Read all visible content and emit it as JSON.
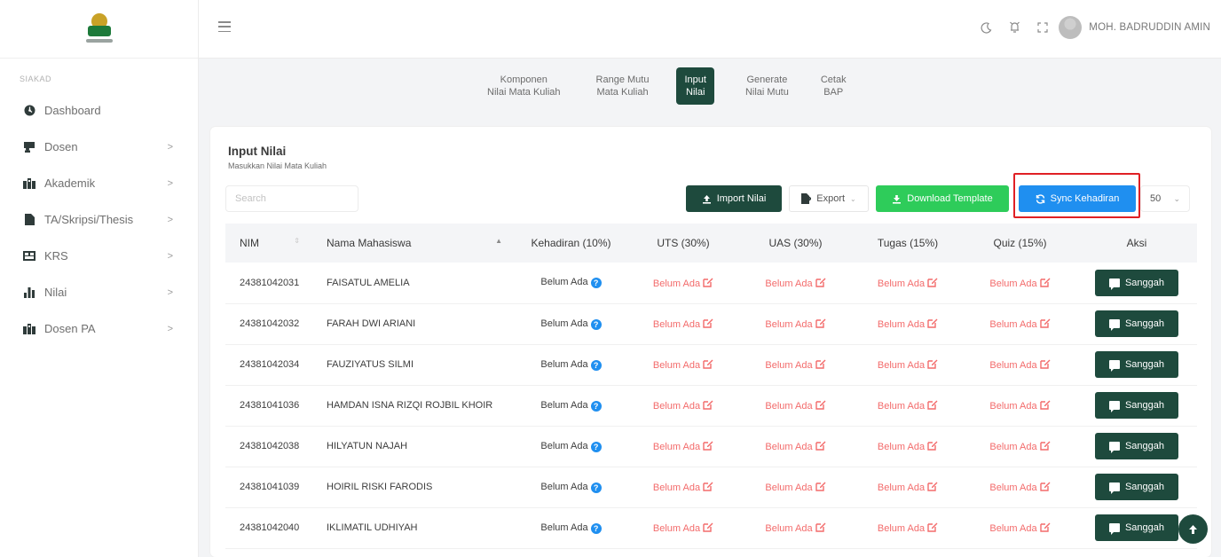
{
  "sidebar": {
    "section_label": "SIAKAD",
    "items": [
      {
        "label": "Dashboard",
        "icon": "dashboard-icon",
        "has_children": false
      },
      {
        "label": "Dosen",
        "icon": "lecturer-icon",
        "has_children": true
      },
      {
        "label": "Akademik",
        "icon": "academic-icon",
        "has_children": true
      },
      {
        "label": "TA/Skripsi/Thesis",
        "icon": "document-icon",
        "has_children": true
      },
      {
        "label": "KRS",
        "icon": "krs-icon",
        "has_children": true
      },
      {
        "label": "Nilai",
        "icon": "bar-chart-icon",
        "has_children": true
      },
      {
        "label": "Dosen PA",
        "icon": "advisor-icon",
        "has_children": true
      }
    ]
  },
  "header": {
    "user_name": "MOH. BADRUDDIN AMIN"
  },
  "tabs": [
    {
      "line1": "Komponen",
      "line2": "Nilai Mata Kuliah",
      "active": false
    },
    {
      "line1": "Range Mutu",
      "line2": "Mata Kuliah",
      "active": false
    },
    {
      "line1": "Input",
      "line2": "Nilai",
      "active": true
    },
    {
      "line1": "Generate",
      "line2": "Nilai Mutu",
      "active": false
    },
    {
      "line1": "Cetak",
      "line2": "BAP",
      "active": false
    }
  ],
  "card": {
    "title": "Input Nilai",
    "subtitle": "Masukkan Nilai Mata Kuliah"
  },
  "toolbar": {
    "search_placeholder": "Search",
    "import_label": "Import Nilai",
    "export_label": "Export",
    "template_label": "Download Template",
    "sync_label": "Sync Kehadiran",
    "per_page": "50"
  },
  "table": {
    "headers": [
      "NIM",
      "Nama Mahasiswa",
      "Kehadiran (10%)",
      "UTS (30%)",
      "UAS (30%)",
      "Tugas (15%)",
      "Quiz (15%)",
      "Aksi"
    ],
    "empty_value": "Belum Ada",
    "action_label": "Sanggah",
    "rows": [
      {
        "nim": "24381042031",
        "nama": "FAISATUL AMELIA"
      },
      {
        "nim": "24381042032",
        "nama": "FARAH DWI ARIANI"
      },
      {
        "nim": "24381042034",
        "nama": "FAUZIYATUS SILMI"
      },
      {
        "nim": "24381041036",
        "nama": "HAMDAN ISNA RIZQI ROJBIL KHOIR"
      },
      {
        "nim": "24381042038",
        "nama": "HILYATUN NAJAH"
      },
      {
        "nim": "24381041039",
        "nama": "HOIRIL RISKI FARODIS"
      },
      {
        "nim": "24381042040",
        "nama": "IKLIMATIL UDHIYAH"
      }
    ]
  },
  "colors": {
    "primary_dark_green": "#1e4a3d",
    "template_green": "#2ecc5a",
    "sync_blue": "#1f8ff0",
    "empty_red": "#f36b6b",
    "highlight_red": "#e01f24"
  }
}
